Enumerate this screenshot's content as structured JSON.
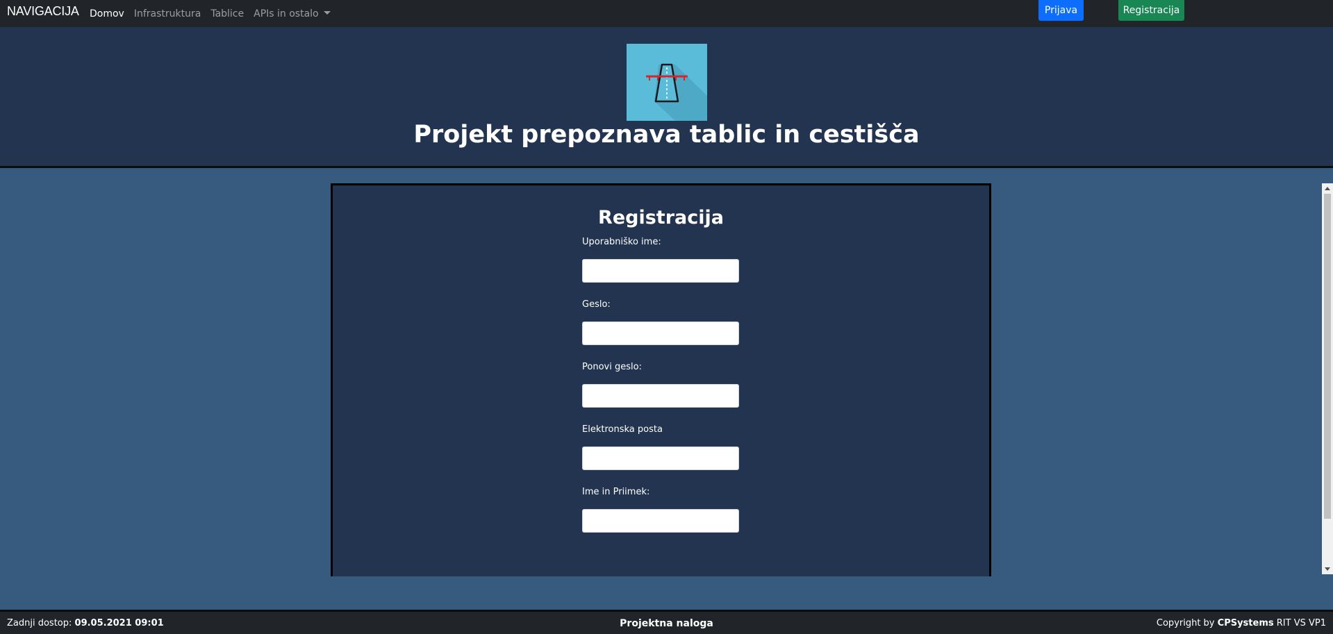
{
  "nav": {
    "brand": "NAVIGACIJA",
    "links": [
      "Domov",
      "Infrastruktura",
      "Tablice",
      "APIs in ostalo"
    ],
    "login_label": "Prijava",
    "register_label": "Registracija"
  },
  "header": {
    "title": "Projekt prepoznava tablic in cestišča"
  },
  "form": {
    "title": "Registracija",
    "fields": [
      {
        "label": "Uporabniško ime:",
        "value": ""
      },
      {
        "label": "Geslo:",
        "value": ""
      },
      {
        "label": "Ponovi geslo:",
        "value": ""
      },
      {
        "label": "Elektronska posta",
        "value": ""
      },
      {
        "label": "Ime in Priimek:",
        "value": ""
      }
    ]
  },
  "footer": {
    "last_access_label": "Zadnji dostop:",
    "last_access_value": "09.05.2021 09:01",
    "center": "Projektna naloga",
    "copyright_prefix": "Copyright by",
    "copyright_company": "CPSystems",
    "copyright_suffix": "RIT VS VP1"
  },
  "colors": {
    "nav_bg": "#212529",
    "header_bg": "#22344f",
    "page_bg": "#375a7f",
    "login_button": "#0d6efd",
    "register_button": "#198754",
    "logo_bg": "#5bbcd9"
  },
  "icons": {
    "logo": "road-bridge-icon"
  }
}
